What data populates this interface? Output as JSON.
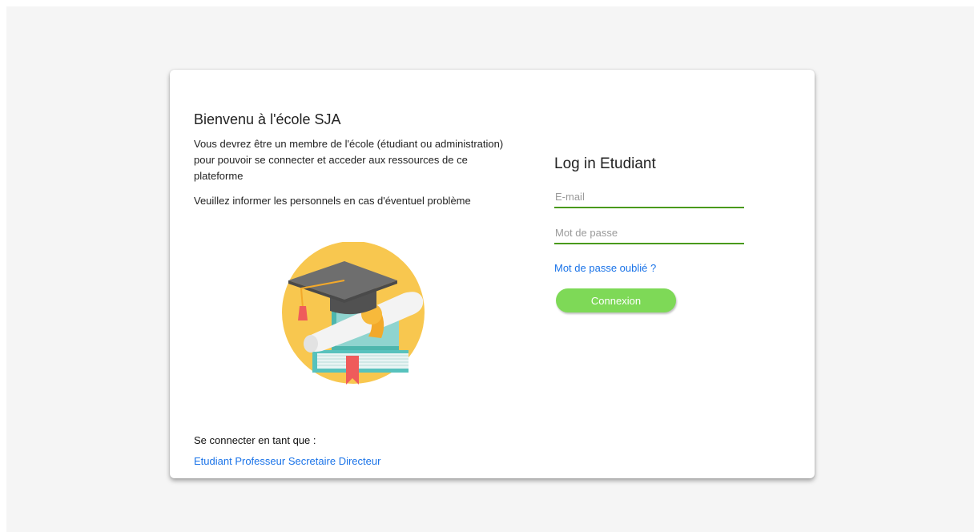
{
  "welcome": {
    "title": "Bienvenu à l'école SJA",
    "intro": "Vous devrez être un membre de l'école (étudiant ou administration) pour pouvoir se connecter et acceder aux ressources de ce plateforme",
    "warning": "Veuillez informer les personnels en cas d'éventuel problème"
  },
  "roles": {
    "heading": "Se connecter en tant que :",
    "items": [
      "Etudiant",
      "Professeur",
      "Secretaire",
      "Directeur"
    ]
  },
  "login": {
    "title": "Log in Etudiant",
    "email_placeholder": "E-mail",
    "password_placeholder": "Mot de passe",
    "forgot_label": "Mot de passe oublié ?",
    "submit_label": "Connexion"
  },
  "colors": {
    "accent_green": "#7ed957",
    "underline_green": "#4a9a1a",
    "link_blue": "#1a73e8",
    "illustration_circle": "#f8c74f"
  },
  "icons": {
    "illustration": "graduation-books-icon"
  }
}
